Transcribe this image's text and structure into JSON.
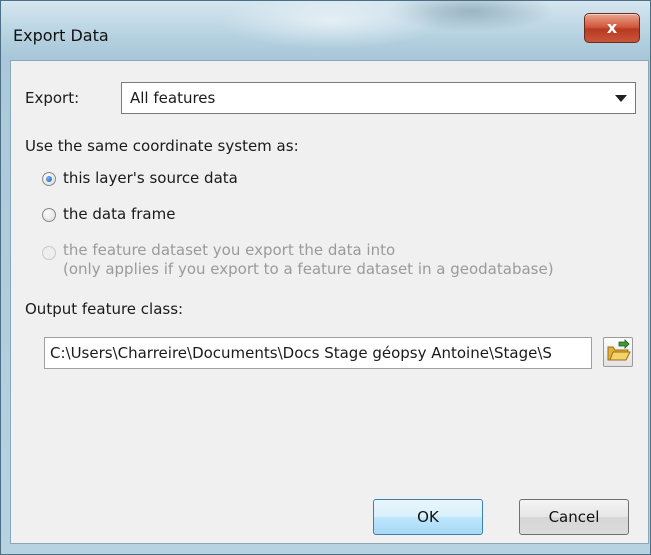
{
  "window": {
    "title": "Export Data",
    "close_label": "x"
  },
  "export": {
    "label": "Export:",
    "selected": "All features"
  },
  "coordinate": {
    "heading": "Use the same coordinate system as:",
    "options": [
      {
        "label": "this layer's source data",
        "checked": true,
        "enabled": true
      },
      {
        "label": "the data frame",
        "checked": false,
        "enabled": true
      },
      {
        "label": "the feature dataset you export the data into",
        "sublabel": "(only applies if you export to a feature dataset in a geodatabase)",
        "checked": false,
        "enabled": false
      }
    ]
  },
  "output": {
    "label": "Output feature class:",
    "path": "C:\\Users\\Charreire\\Documents\\Docs Stage géopsy Antoine\\Stage\\S"
  },
  "buttons": {
    "ok": "OK",
    "cancel": "Cancel"
  }
}
